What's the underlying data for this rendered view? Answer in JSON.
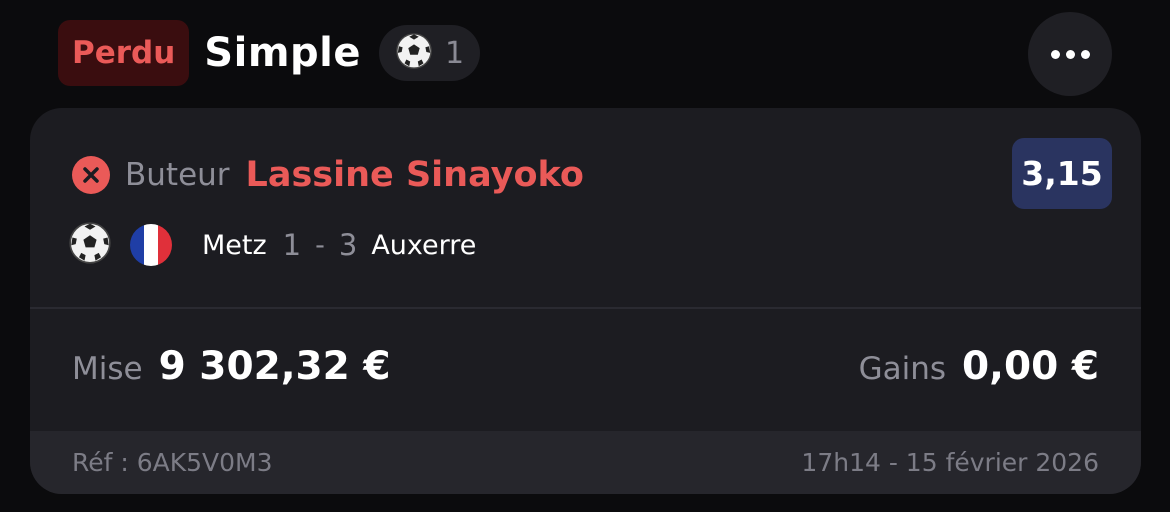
{
  "header": {
    "status": "Perdu",
    "bet_type": "Simple",
    "sport_icon": "soccer-ball-icon",
    "selection_count": "1",
    "more_icon": "more-horizontal-icon"
  },
  "selection": {
    "result_icon": "x-circle-icon",
    "market": "Buteur",
    "player": "Lassine Sinayoko",
    "odds": "3,15",
    "country_flag": "france-flag-icon",
    "home_team": "Metz",
    "home_score": "1",
    "score_separator": "-",
    "away_score": "3",
    "away_team": "Auxerre"
  },
  "summary": {
    "stake_label": "Mise",
    "stake_value": "9 302,32 €",
    "gains_label": "Gains",
    "gains_value": "0,00 €"
  },
  "footer": {
    "reference": "Réf : 6AK5V0M3",
    "datetime": "17h14 - 15 février 2026"
  },
  "colors": {
    "lost_red": "#ea5a58",
    "odds_bg": "#2a3460",
    "card_bg": "#1c1c21"
  }
}
